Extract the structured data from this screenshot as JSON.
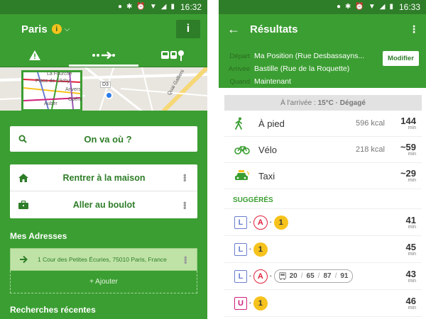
{
  "left": {
    "status": {
      "time": "16:32"
    },
    "header": {
      "city": "Paris",
      "info_badge": "i",
      "info_button": "i"
    },
    "map": {
      "labels": [
        "La Fourche",
        "Place de Clichy",
        "Anvers",
        "Auber",
        "Opéra",
        "D3",
        "Quai Gallieni"
      ]
    },
    "search": {
      "label": "On va où ?"
    },
    "quick": {
      "home": "Rentrer à la maison",
      "work": "Aller au boulot"
    },
    "addresses": {
      "title": "Mes Adresses",
      "items": [
        "1 Cour des Petites Écuries, 75010 Paris, France"
      ],
      "add_label": "+ Ajouter"
    },
    "recent": {
      "title": "Recherches récentes"
    }
  },
  "right": {
    "status": {
      "time": "16:33"
    },
    "header": {
      "title": "Résultats"
    },
    "trip": {
      "depart_key": "Départ",
      "depart_value": "Ma Position (Rue Desbassayns...",
      "arrivee_key": "Arrivée",
      "arrivee_value": "Bastille (Rue de la Roquette)",
      "quand_key": "Quand",
      "quand_value": "Maintenant",
      "modify_label": "Modifier"
    },
    "weather": {
      "prefix": "À l'arrivée : ",
      "value": "15°C · Dégagé"
    },
    "modes": [
      {
        "label": "À pied",
        "kcal": "596 kcal",
        "duration": "144",
        "unit": "min"
      },
      {
        "label": "Vélo",
        "kcal": "218 kcal",
        "duration": "~59",
        "unit": "min"
      },
      {
        "label": "Taxi",
        "kcal": "",
        "duration": "~29",
        "unit": "min"
      }
    ],
    "suggested_title": "SUGGÉRÉS",
    "routes": [
      {
        "duration": "41",
        "unit": "min",
        "chips": [
          "L",
          "A",
          "1"
        ]
      },
      {
        "duration": "45",
        "unit": "min",
        "chips": [
          "L",
          "1"
        ]
      },
      {
        "duration": "43",
        "unit": "min",
        "chips": [
          "L",
          "A",
          "bus"
        ],
        "bus_lines": [
          "20",
          "65",
          "87",
          "91"
        ]
      },
      {
        "duration": "46",
        "unit": "min",
        "chips": [
          "U",
          "1"
        ]
      }
    ],
    "colors": {
      "accent": "#3b9e32",
      "dark": "#2e7d28"
    }
  }
}
